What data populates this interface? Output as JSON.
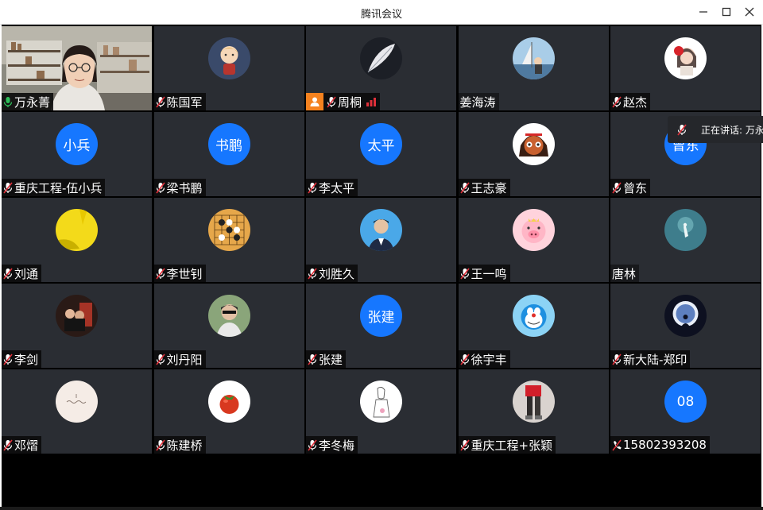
{
  "window": {
    "title": "腾讯会议",
    "minimize_icon": "minimize-icon",
    "maximize_icon": "maximize-icon",
    "close_icon": "close-icon"
  },
  "colors": {
    "tile_bg": "#2a2d33",
    "text_avatar_bg": "#1677ff",
    "active_border": "#2fbf5a",
    "mic_on": "#2fbf5a",
    "mic_muted": "#e0303a",
    "user_badge": "#f5821f"
  },
  "speaking": {
    "label": "正在讲话: 万永",
    "icon": "microphone-muted-icon"
  },
  "participants": [
    {
      "name": "万永菁",
      "mic": "on",
      "avatar": "video",
      "active": true
    },
    {
      "name": "陈国军",
      "mic": "muted",
      "avatar": "cartoon-boy-avatar"
    },
    {
      "name": "周桐",
      "mic": "muted",
      "avatar": "feather-avatar",
      "badge": "user-icon",
      "signal": "signal-icon"
    },
    {
      "name": "姜海涛",
      "mic": "none",
      "avatar": "sailboat-avatar"
    },
    {
      "name": "赵杰",
      "mic": "muted",
      "avatar": "girl-with-flower-avatar"
    },
    {
      "name": "重庆工程-伍小兵",
      "mic": "muted",
      "avatar_text": "小兵"
    },
    {
      "name": "梁书鹏",
      "mic": "muted",
      "avatar_text": "书鹏"
    },
    {
      "name": "李太平",
      "mic": "muted",
      "avatar_text": "太平"
    },
    {
      "name": "王志豪",
      "mic": "muted",
      "avatar": "cartoon-girl-avatar"
    },
    {
      "name": "曾东",
      "mic": "muted",
      "avatar_text": "曾东"
    },
    {
      "name": "刘通",
      "mic": "muted",
      "avatar": "yellow-avatar"
    },
    {
      "name": "李世钊",
      "mic": "muted",
      "avatar": "go-board-avatar"
    },
    {
      "name": "刘胜久",
      "mic": "muted",
      "avatar": "portrait-man-avatar"
    },
    {
      "name": "王一鸣",
      "mic": "muted",
      "avatar": "pink-pig-avatar"
    },
    {
      "name": "唐林",
      "mic": "none",
      "avatar": "underwater-avatar"
    },
    {
      "name": "李剑",
      "mic": "muted",
      "avatar": "couple-photo-avatar"
    },
    {
      "name": "刘丹阳",
      "mic": "muted",
      "avatar": "man-sunglasses-avatar"
    },
    {
      "name": "张建",
      "mic": "muted",
      "avatar_text": "张建"
    },
    {
      "name": "徐宇丰",
      "mic": "muted",
      "avatar": "doraemon-avatar"
    },
    {
      "name": "新大陆-郑印",
      "mic": "muted",
      "avatar": "moon-figure-avatar"
    },
    {
      "name": "邓熠",
      "mic": "muted",
      "avatar": "handwriting-avatar"
    },
    {
      "name": "陈建桥",
      "mic": "muted",
      "avatar": "tomato-avatar"
    },
    {
      "name": "李冬梅",
      "mic": "muted",
      "avatar": "sketch-girl-avatar"
    },
    {
      "name": "重庆工程+张颖",
      "mic": "muted",
      "avatar": "walking-legs-avatar"
    },
    {
      "name": "15802393208",
      "mic": "phone",
      "avatar_text": "08"
    }
  ]
}
